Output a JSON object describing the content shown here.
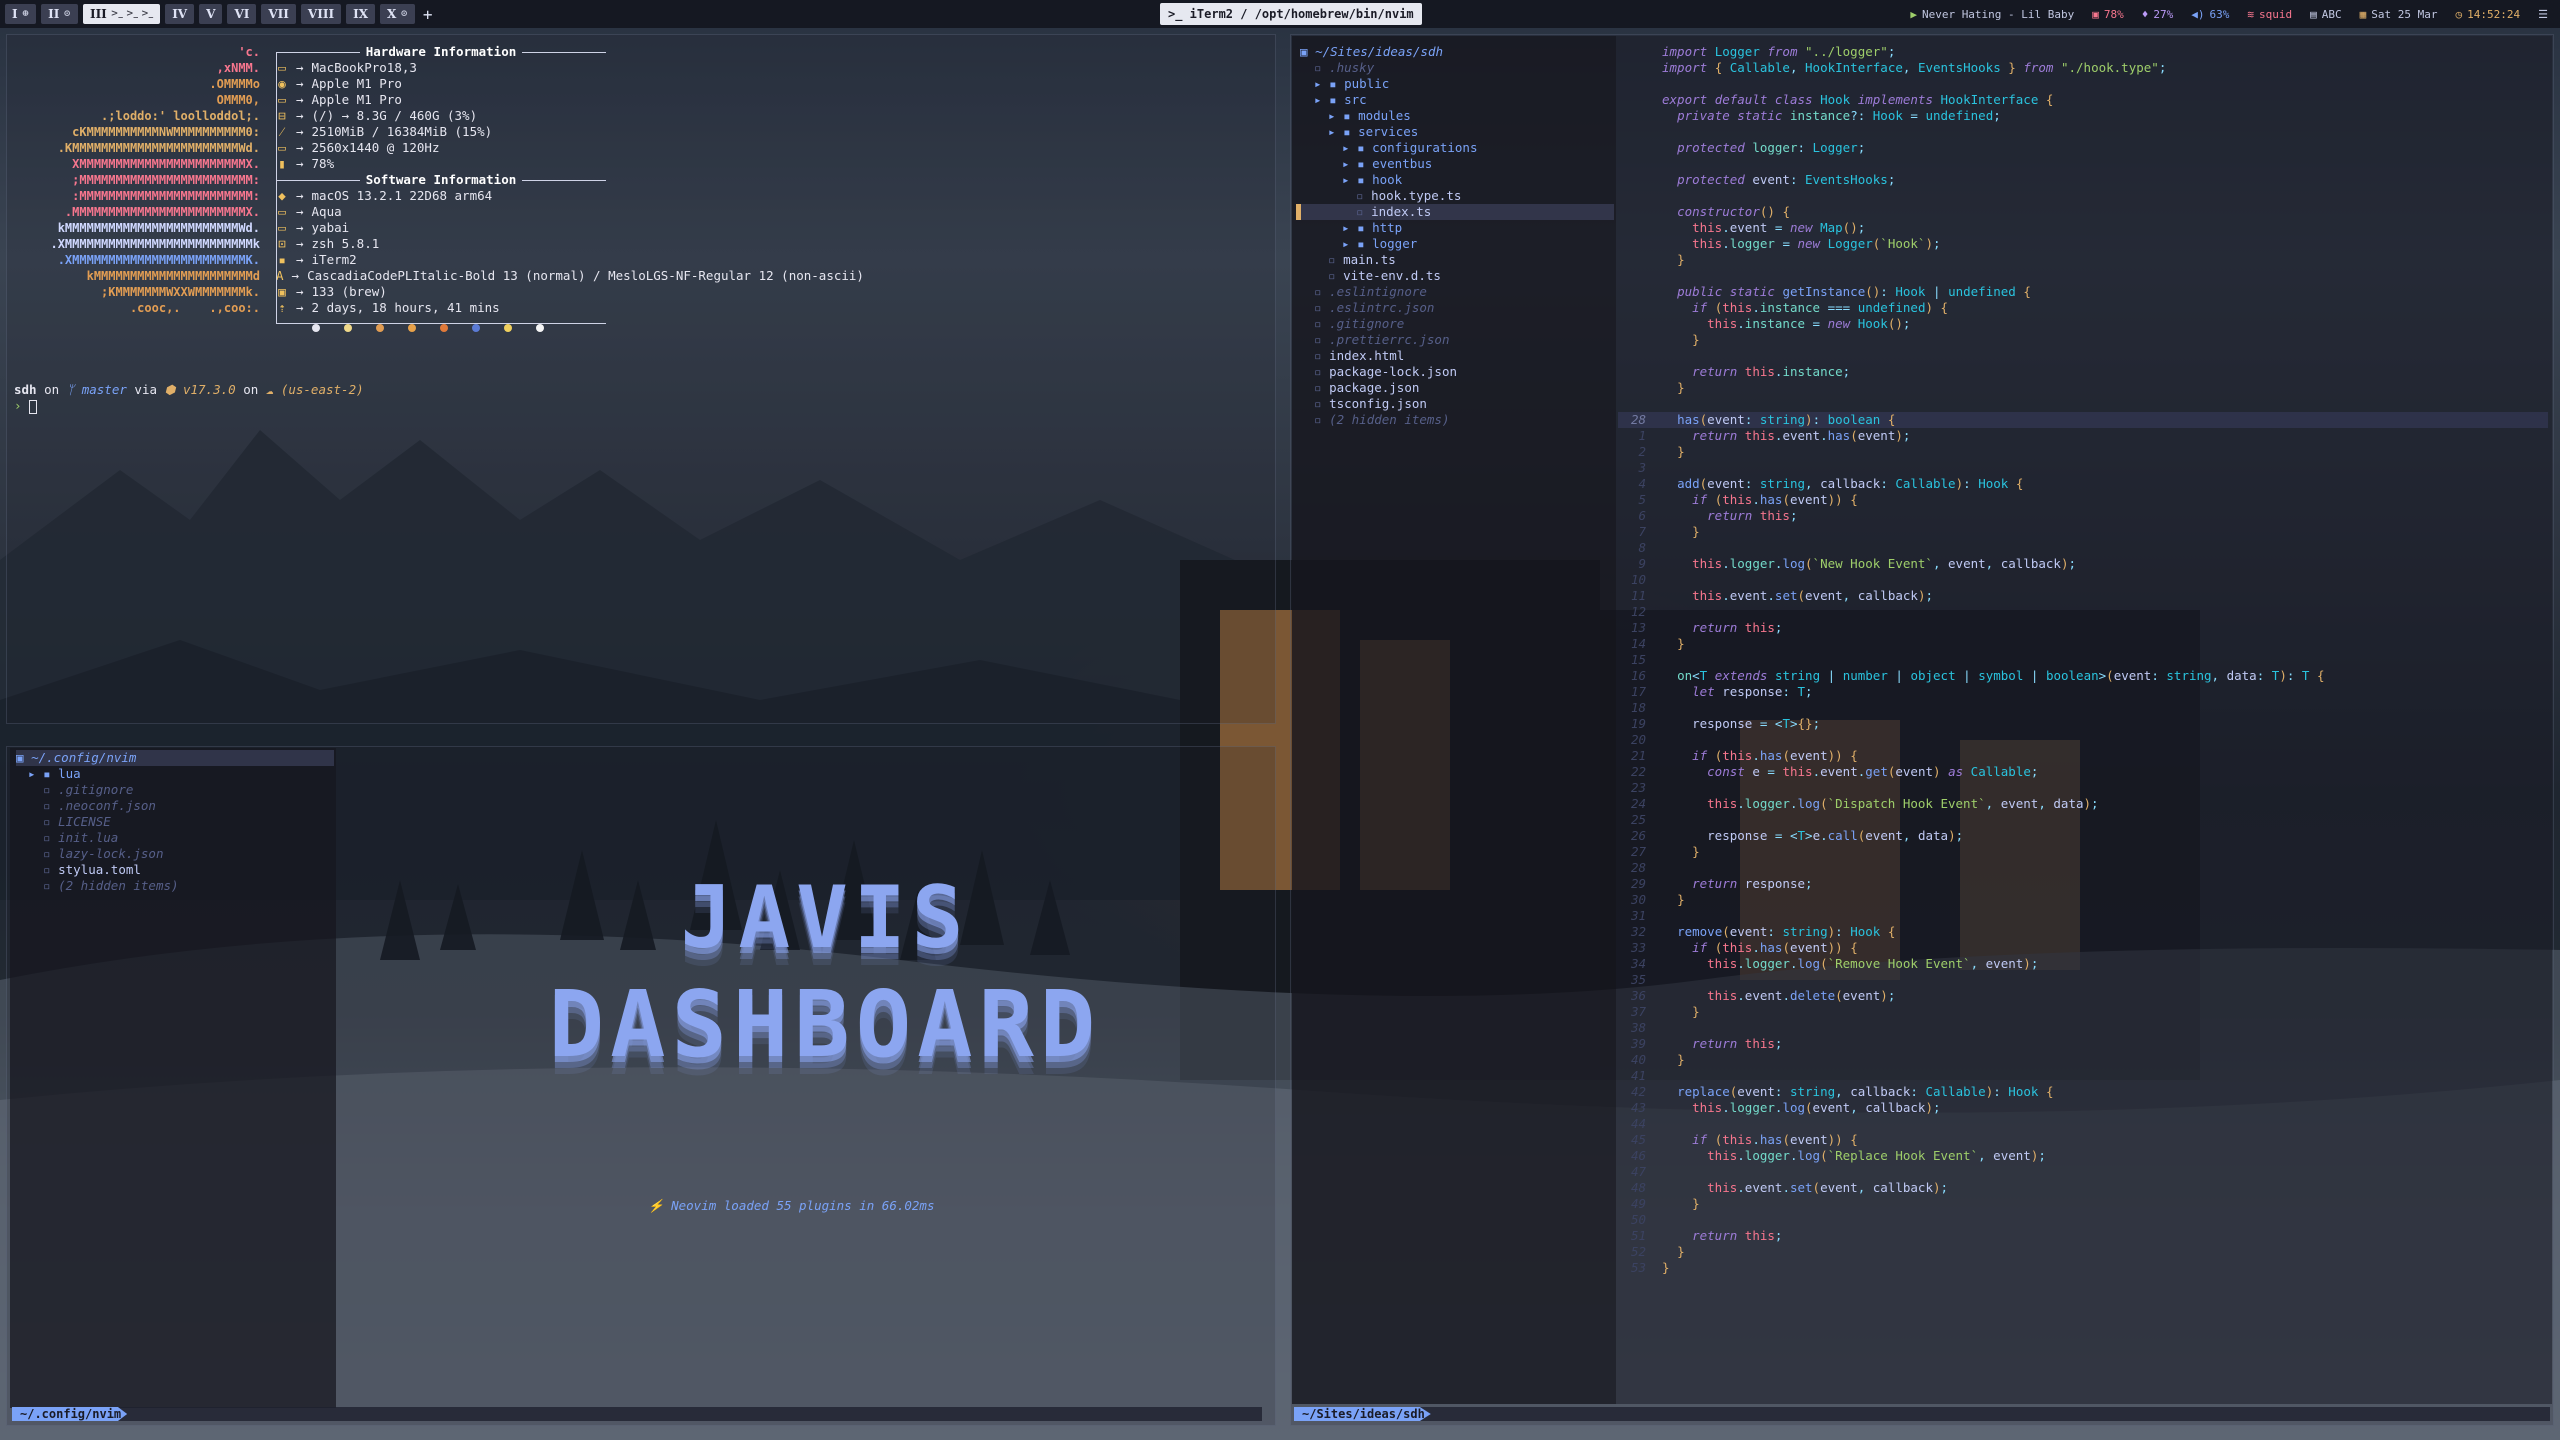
{
  "topbar": {
    "workspaces": [
      {
        "label": "I",
        "icon": "⊕",
        "active": false
      },
      {
        "label": "II",
        "icon": "⊙",
        "active": false
      },
      {
        "label": "III",
        "icon": ">_ >_ >_",
        "active": true
      },
      {
        "label": "IV",
        "icon": "",
        "active": false
      },
      {
        "label": "V",
        "icon": "",
        "active": false
      },
      {
        "label": "VI",
        "icon": "",
        "active": false
      },
      {
        "label": "VII",
        "icon": "",
        "active": false
      },
      {
        "label": "VIII",
        "icon": "",
        "active": false
      },
      {
        "label": "IX",
        "icon": "",
        "active": false
      },
      {
        "label": "X",
        "icon": "⊙",
        "active": false
      }
    ],
    "add_label": "+",
    "window_title": ">_ iTerm2 / /opt/homebrew/bin/nvim",
    "status": {
      "music": "Never Hating - Lil Baby",
      "battery": "78%",
      "mic": "27%",
      "volume": "63%",
      "wifi": "squid",
      "keyboard": "ABC",
      "date": "Sat 25 Mar",
      "time": "14:52:24"
    }
  },
  "neofetch": {
    "ascii": [
      "'c.",
      ",xNMM.",
      ".OMMMMo",
      "OMMM0,",
      ".;loddo:' loolloddol;.",
      "cKMMMMMMMMMMNWMMMMMMMMMM0:",
      ".KMMMMMMMMMMMMMMMMMMMMMMMWd.",
      "XMMMMMMMMMMMMMMMMMMMMMMMX.",
      ";MMMMMMMMMMMMMMMMMMMMMMMM:",
      ":MMMMMMMMMMMMMMMMMMMMMMMM:",
      ".MMMMMMMMMMMMMMMMMMMMMMMMX.",
      "kMMMMMMMMMMMMMMMMMMMMMMMMWd.",
      ".XMMMMMMMMMMMMMMMMMMMMMMMMMMk",
      ".XMMMMMMMMMMMMMMMMMMMMMMMMK.",
      "kMMMMMMMMMMMMMMMMMMMMMMd",
      ";KMMMMMMMWXXWMMMMMMMk.",
      ".cooc,.    .,coo:."
    ],
    "hardware_title": "Hardware Information",
    "hardware": [
      {
        "icon": "▭",
        "value": "MacBookPro18,3"
      },
      {
        "icon": "◉",
        "value": "Apple M1 Pro"
      },
      {
        "icon": "▭",
        "value": "Apple M1 Pro"
      },
      {
        "icon": "⊟",
        "value": "(/) → 8.3G / 460G (3%)"
      },
      {
        "icon": "⁄",
        "value": "2510MiB / 16384MiB (15%)"
      },
      {
        "icon": "▭",
        "value": "2560x1440 @ 120Hz"
      },
      {
        "icon": "▮",
        "value": "78%"
      }
    ],
    "software_title": "Software Information",
    "software": [
      {
        "icon": "◆",
        "value": "macOS 13.2.1 22D68 arm64"
      },
      {
        "icon": "▭",
        "value": "Aqua"
      },
      {
        "icon": "▭",
        "value": "yabai"
      },
      {
        "icon": "⊡",
        "value": "zsh 5.8.1"
      },
      {
        "icon": "▪",
        "value": "iTerm2"
      },
      {
        "icon": "A",
        "value": "CascadiaCodePLItalic-Bold 13 (normal) / MesloLGS-NF-Regular 12 (non-ascii)"
      },
      {
        "icon": "▣",
        "value": "133 (brew)"
      },
      {
        "icon": "⇡",
        "value": "2 days, 18 hours, 41 mins"
      }
    ],
    "palette": [
      "#e6e6f0",
      "#f0d98a",
      "#e29d53",
      "#e8a24a",
      "#e07a3a",
      "#5b7bd5",
      "#f0d05e",
      "#f5f5f5"
    ],
    "arrow": "→"
  },
  "prompt": {
    "user": "sdh",
    "on": "on",
    "branch": "ᛘ master",
    "via": "via",
    "node": "⬢ v17.3.0",
    "on2": "on",
    "region": "☁  (us-east-2)",
    "symbol": "›"
  },
  "nvim_left": {
    "root": "~/.config/nvim",
    "items": [
      {
        "name": "lua",
        "kind": "dir"
      },
      {
        "name": ".gitignore",
        "kind": "dim"
      },
      {
        "name": ".neoconf.json",
        "kind": "dim"
      },
      {
        "name": "LICENSE",
        "kind": "dim"
      },
      {
        "name": "init.lua",
        "kind": "dim"
      },
      {
        "name": "lazy-lock.json",
        "kind": "dim"
      },
      {
        "name": "stylua.toml",
        "kind": "file"
      },
      {
        "name": "(2 hidden items)",
        "kind": "dim"
      }
    ],
    "logo_line1": "JAVIS",
    "logo_line2": "DASHBOARD",
    "loaded": "⚡  Neovim loaded 55 plugins in 66.02ms",
    "statusline": "~/.config/nvim"
  },
  "nvim_right": {
    "root": "~/Sites/ideas/sdh",
    "tree": [
      {
        "name": ".husky",
        "kind": "dim",
        "depth": 1
      },
      {
        "name": "public",
        "kind": "dir",
        "depth": 1
      },
      {
        "name": "src",
        "kind": "dir",
        "depth": 1
      },
      {
        "name": "modules",
        "kind": "dir",
        "depth": 2
      },
      {
        "name": "services",
        "kind": "dir",
        "depth": 2
      },
      {
        "name": "configurations",
        "kind": "dir",
        "depth": 3
      },
      {
        "name": "eventbus",
        "kind": "dir",
        "depth": 3
      },
      {
        "name": "hook",
        "kind": "dir",
        "depth": 3
      },
      {
        "name": "hook.type.ts",
        "kind": "file",
        "depth": 4
      },
      {
        "name": "index.ts",
        "kind": "file",
        "depth": 4
      },
      {
        "name": "http",
        "kind": "dir",
        "depth": 3
      },
      {
        "name": "logger",
        "kind": "dir",
        "depth": 3
      },
      {
        "name": "main.ts",
        "kind": "file",
        "depth": 2
      },
      {
        "name": "vite-env.d.ts",
        "kind": "file",
        "depth": 2
      },
      {
        "name": ".eslintignore",
        "kind": "dim",
        "depth": 1
      },
      {
        "name": ".eslintrc.json",
        "kind": "dim",
        "depth": 1
      },
      {
        "name": ".gitignore",
        "kind": "dim",
        "depth": 1
      },
      {
        "name": ".prettierrc.json",
        "kind": "dim",
        "depth": 1
      },
      {
        "name": "index.html",
        "kind": "file",
        "depth": 1
      },
      {
        "name": "package-lock.json",
        "kind": "file",
        "depth": 1
      },
      {
        "name": "package.json",
        "kind": "file",
        "depth": 1
      },
      {
        "name": "tsconfig.json",
        "kind": "file",
        "depth": 1
      },
      {
        "name": "(2 hidden items)",
        "kind": "dim",
        "depth": 1
      }
    ],
    "statusline": "~/Sites/ideas/sdh",
    "current_line_number": "28",
    "code": [
      "import Logger from \"../logger\";",
      "import { Callable, HookInterface, EventsHooks } from \"./hook.type\";",
      "",
      "export default class Hook implements HookInterface {",
      "  private static instance?: Hook = undefined;",
      "",
      "  protected logger: Logger;",
      "",
      "  protected event: EventsHooks;",
      "",
      "  constructor() {",
      "    this.event = new Map();",
      "    this.logger = new Logger(`Hook`);",
      "  }",
      "",
      "  public static getInstance(): Hook | undefined {",
      "    if (this.instance === undefined) {",
      "      this.instance = new Hook();",
      "    }",
      "",
      "    return this.instance;",
      "  }",
      "",
      "  has(event: string): boolean {",
      "    return this.event.has(event);",
      "  }",
      "",
      "  add(event: string, callback: Callable): Hook {",
      "    if (this.has(event)) {",
      "      return this;",
      "    }",
      "",
      "    this.logger.log(`New Hook Event`, event, callback);",
      "",
      "    this.event.set(event, callback);",
      "",
      "    return this;",
      "  }",
      "",
      "  on<T extends string | number | object | symbol | boolean>(event: string, data: T): T {",
      "    let response: T;",
      "",
      "    response = <T>{};",
      "",
      "    if (this.has(event)) {",
      "      const e = this.event.get(event) as Callable;",
      "",
      "      this.logger.log(`Dispatch Hook Event`, event, data);",
      "",
      "      response = <T>e.call(event, data);",
      "    }",
      "",
      "    return response;",
      "  }",
      "",
      "  remove(event: string): Hook {",
      "    if (this.has(event)) {",
      "      this.logger.log(`Remove Hook Event`, event);",
      "",
      "      this.event.delete(event);",
      "    }",
      "",
      "    return this;",
      "  }",
      "",
      "  replace(event: string, callback: Callable): Hook {",
      "    this.logger.log(event, callback);",
      "",
      "    if (this.has(event)) {",
      "      this.logger.log(`Replace Hook Event`, event);",
      "",
      "      this.event.set(event, callback);",
      "    }",
      "",
      "    return this;",
      "  }",
      "}"
    ],
    "line_numbers": [
      "",
      "",
      "",
      "",
      "",
      "",
      "",
      "",
      "",
      "",
      "",
      "",
      "",
      "",
      "",
      "",
      "",
      "",
      "",
      "",
      "",
      "",
      "",
      "28",
      "1",
      "2",
      "3",
      "4",
      "5",
      "6",
      "7",
      "8",
      "9",
      "10",
      "11",
      "12",
      "13",
      "14",
      "15",
      "16",
      "17",
      "18",
      "19",
      "20",
      "21",
      "22",
      "23",
      "24",
      "25",
      "26",
      "27",
      "28",
      "29",
      "30",
      "31",
      "32",
      "33",
      "34",
      "35",
      "36",
      "37",
      "38",
      "39",
      "40",
      "41",
      "42",
      "43",
      "44",
      "45",
      "46",
      "47",
      "48",
      "49",
      "50",
      "51",
      "52",
      "53"
    ]
  }
}
